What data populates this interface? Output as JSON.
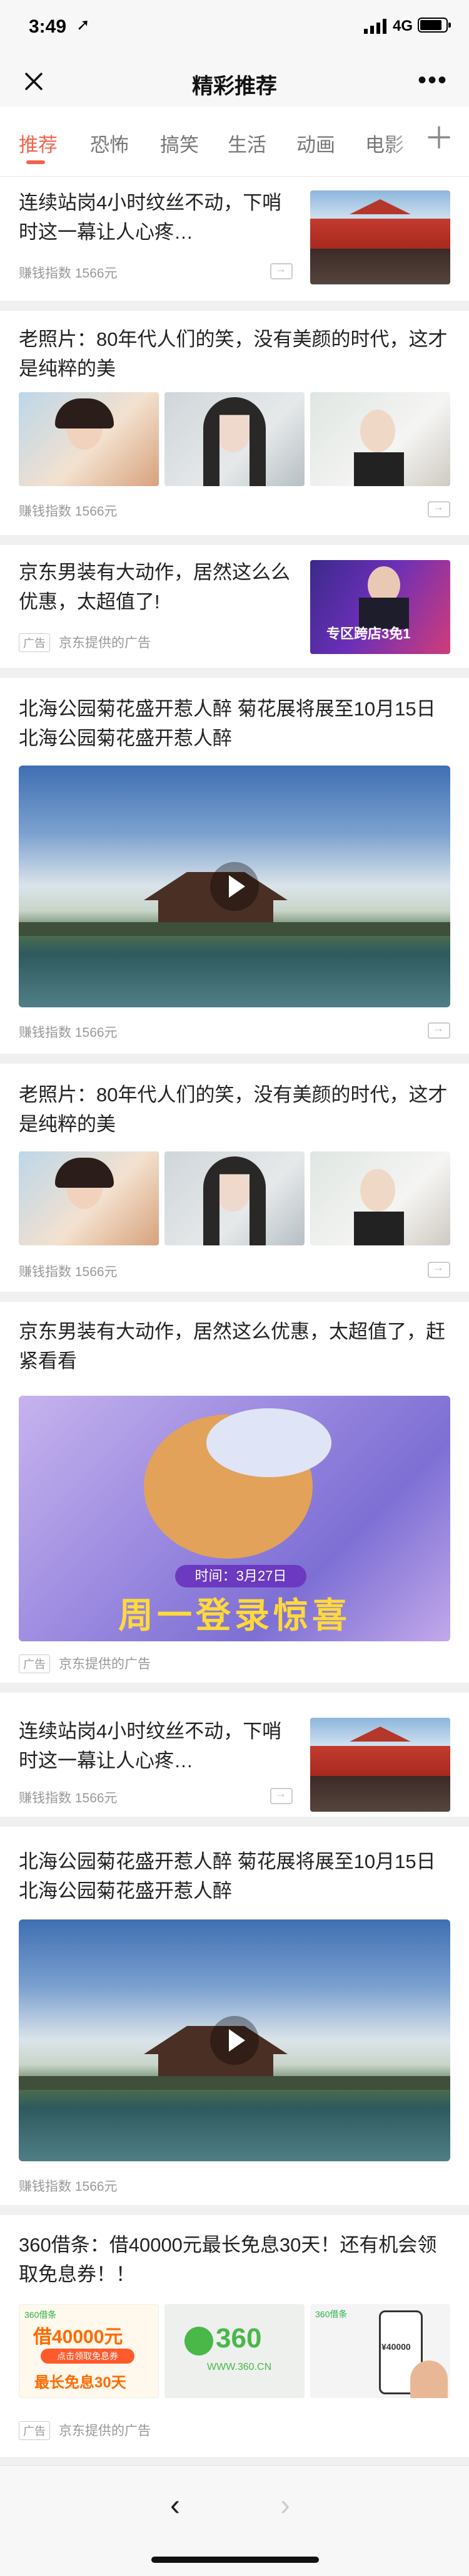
{
  "status_bar": {
    "time": "3:49",
    "network": "4G"
  },
  "nav": {
    "title": "精彩推荐"
  },
  "tabs": [
    "推荐",
    "恐怖",
    "搞笑",
    "生活",
    "动画",
    "电影"
  ],
  "feed": {
    "c1": {
      "title": "连续站岗4小时纹丝不动，下哨时这一幕让人心疼…",
      "meta": "赚钱指数 1566元"
    },
    "c2": {
      "title": "老照片：80年代人们的笑，没有美颜的时代，这才是纯粹的美",
      "meta": "赚钱指数 1566元"
    },
    "c3": {
      "title": "京东男装有大动作，居然这么么优惠，太超值了!",
      "ad_label": "广告",
      "meta": "京东提供的广告",
      "thumb_text": "专区跨店3免1"
    },
    "c4": {
      "title": "北海公园菊花盛开惹人醉 菊花展将展至10月15日北海公园菊花盛开惹人醉",
      "meta": "赚钱指数 1566元"
    },
    "c5": {
      "title": "老照片：80年代人们的笑，没有美颜的时代，这才是纯粹的美",
      "meta": "赚钱指数 1566元"
    },
    "c6": {
      "title": "京东男装有大动作，居然这么优惠，太超值了，赶紧看看",
      "ad_label": "广告",
      "meta": "京东提供的广告",
      "banner_time": "时间：3月27日",
      "banner_title": "周一登录惊喜"
    },
    "c7": {
      "title": "连续站岗4小时纹丝不动，下哨时这一幕让人心疼…",
      "meta": "赚钱指数 1566元"
    },
    "c8": {
      "title": "北海公园菊花盛开惹人醉 菊花展将展至10月15日北海公园菊花盛开惹人醉",
      "meta": "赚钱指数 1566元"
    },
    "c9": {
      "title": "360借条：借40000元最长免息30天！还有机会领取免息券！！",
      "ad_label": "广告",
      "meta": "京东提供的广告",
      "img1_logo": "360借条",
      "img1_amount": "借40000元",
      "img1_button": "点击领取免息券",
      "img1_sub": "最长免息30天",
      "img2_logo": "360",
      "img2_url": "WWW.360.CN",
      "img3_logo": "360借条",
      "img3_amount": "¥40000"
    }
  },
  "icons": {
    "close": "close-icon",
    "more": "more-icon",
    "add_tab": "plus-icon",
    "back": "back-arrow-icon",
    "forward": "forward-arrow-icon",
    "share": "share-icon",
    "play": "play-icon"
  },
  "colors": {
    "accent": "#f2634b",
    "background": "#f0f0f0",
    "bar": "#f7f7f7"
  }
}
